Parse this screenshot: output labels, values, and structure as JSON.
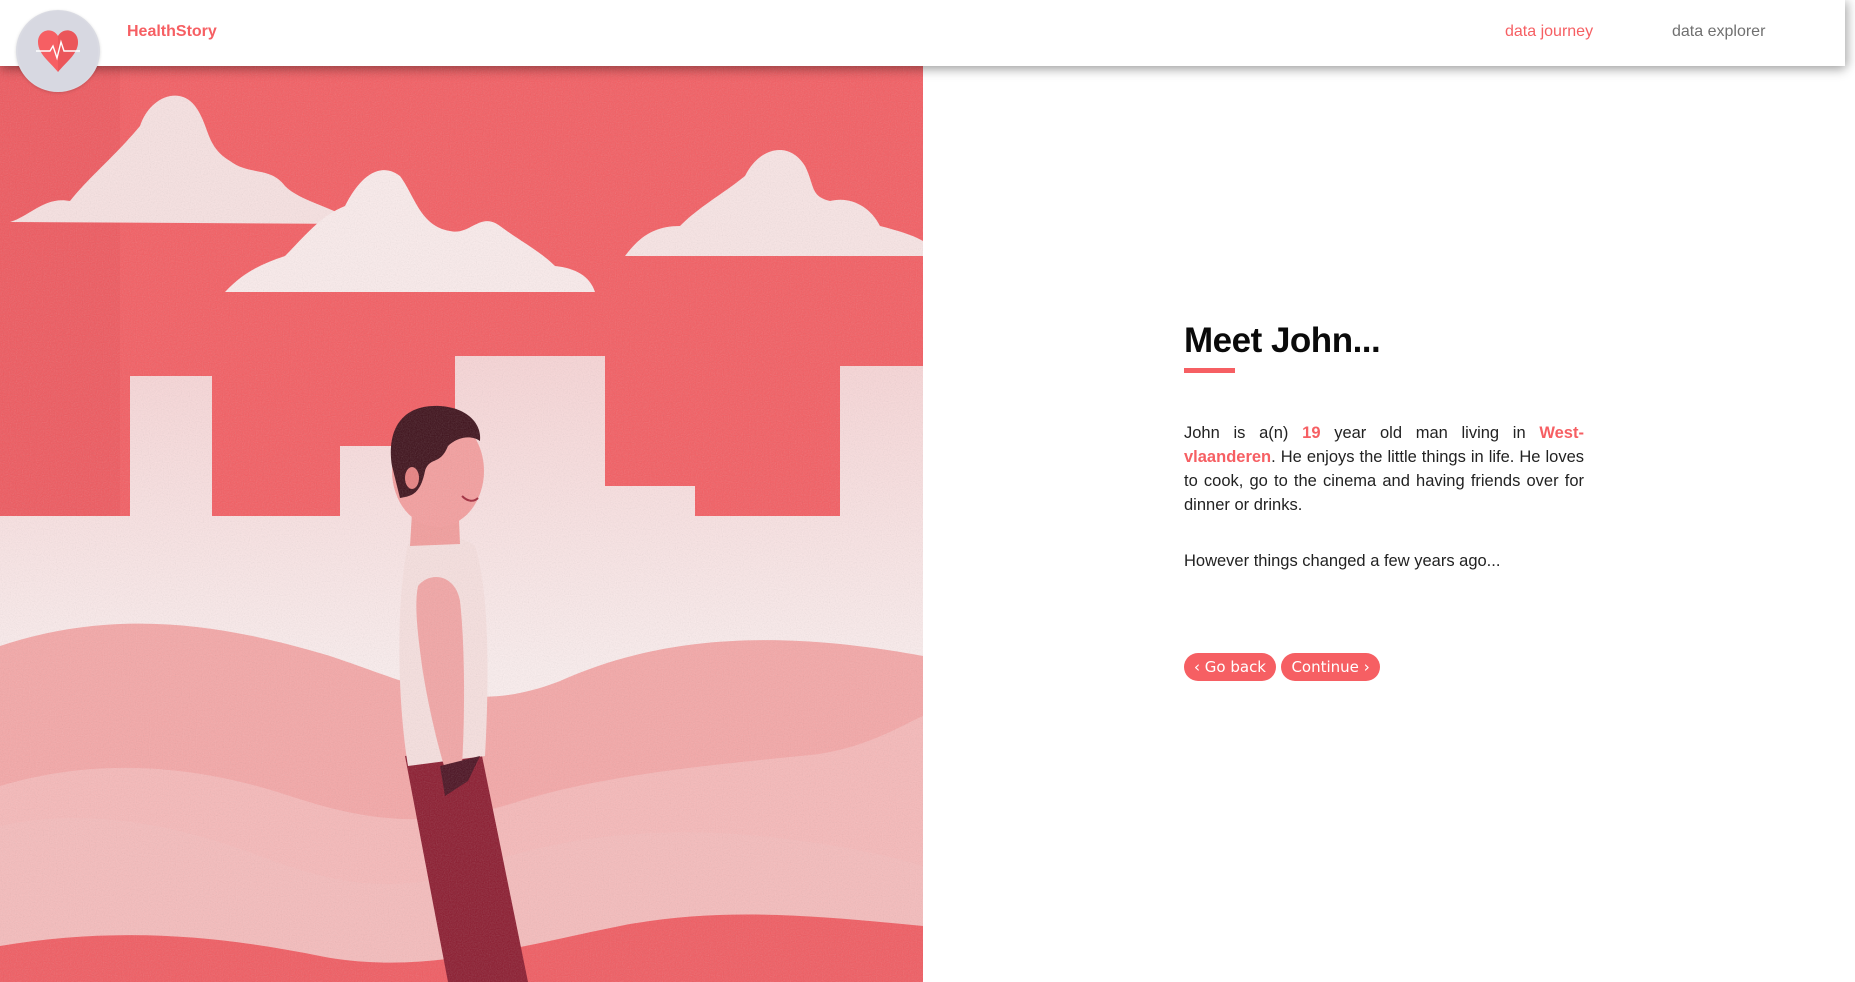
{
  "header": {
    "brand": "HealthStory",
    "nav": [
      {
        "label": "data journey",
        "active": true
      },
      {
        "label": "data explorer",
        "active": false
      }
    ]
  },
  "story": {
    "title": "Meet John...",
    "p1_intro": "John is a(n)",
    "age": "19",
    "p1_mid": "year old man living in",
    "region": "West-vlaanderen",
    "p1_end": ". He enjoys the little things in life. He loves to cook, go to the cinema and having friends over for dinner or drinks.",
    "p2": "However things changed a few years ago..."
  },
  "buttons": {
    "back_icon": "‹",
    "back_label": "Go back",
    "continue_label": "Continue",
    "continue_icon": "›"
  },
  "colors": {
    "accent": "#f65f63",
    "nav_inactive": "#707070",
    "sky": "#f45d62",
    "trousers": "#8b1a2e"
  }
}
